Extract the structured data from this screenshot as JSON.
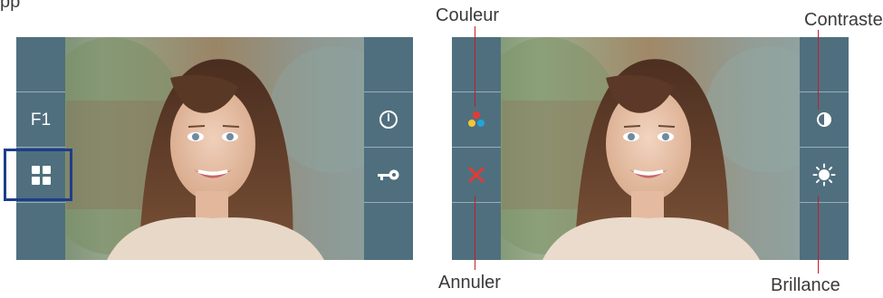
{
  "top_fragment": "pp",
  "left_screen": {
    "left_sidebar": {
      "f1_label": "F1"
    }
  },
  "right_screen": {
    "callouts": {
      "couleur": "Couleur",
      "annuler": "Annuler",
      "contraste": "Contraste",
      "brillance": "Brillance"
    }
  },
  "colors": {
    "sidebar": "#4f6f7e",
    "highlight": "#1f3d8b",
    "callout_line": "#c21d2e",
    "cancel_icon": "#e53935",
    "color_dot_red": "#e53935",
    "color_dot_yellow": "#f6c531",
    "color_dot_blue": "#22a3d8"
  },
  "icons": {
    "grid": "grid-menu-icon",
    "power": "power-icon",
    "key": "door-key-icon",
    "color": "color-dots-icon",
    "cancel": "close-icon",
    "contrast": "contrast-icon",
    "brightness": "brightness-icon"
  }
}
